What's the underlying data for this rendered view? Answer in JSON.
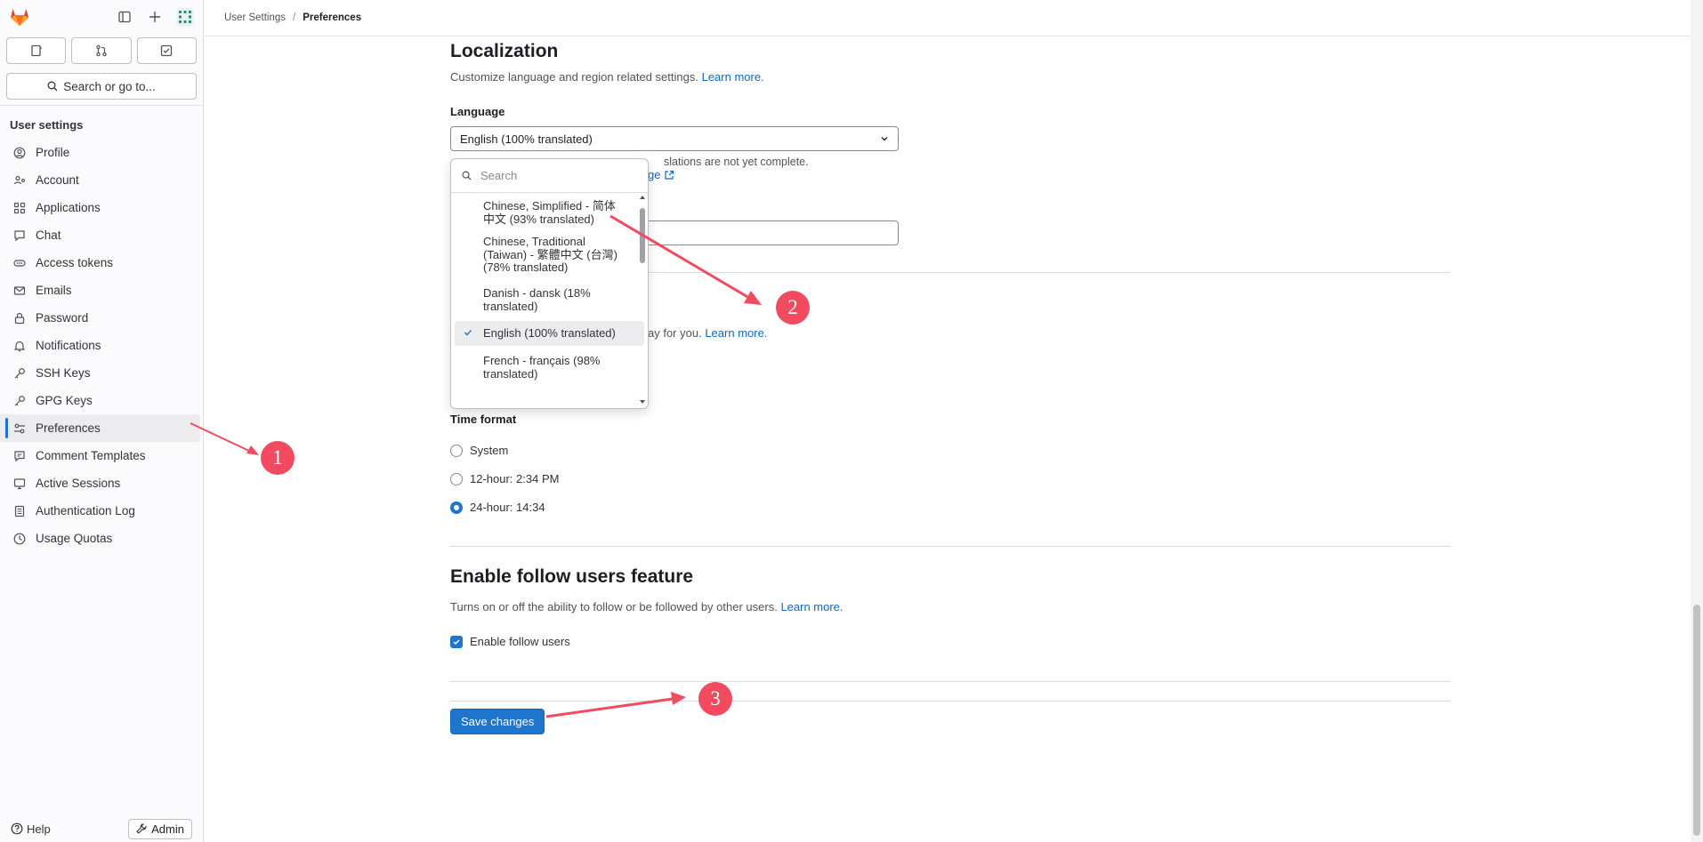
{
  "sidebar": {
    "top_icons": [
      "sidebar-toggle-icon",
      "plus-icon",
      "avatar"
    ],
    "tabs": [
      "issues-icon",
      "merge-request-icon",
      "todo-icon"
    ],
    "search_label": "Search or go to...",
    "heading": "User settings",
    "items": [
      {
        "label": "Profile",
        "icon": "profile-icon"
      },
      {
        "label": "Account",
        "icon": "account-icon"
      },
      {
        "label": "Applications",
        "icon": "applications-icon"
      },
      {
        "label": "Chat",
        "icon": "chat-icon"
      },
      {
        "label": "Access tokens",
        "icon": "token-icon"
      },
      {
        "label": "Emails",
        "icon": "email-icon"
      },
      {
        "label": "Password",
        "icon": "lock-icon"
      },
      {
        "label": "Notifications",
        "icon": "bell-icon"
      },
      {
        "label": "SSH Keys",
        "icon": "key-icon"
      },
      {
        "label": "GPG Keys",
        "icon": "key-icon"
      },
      {
        "label": "Preferences",
        "icon": "preferences-icon",
        "active": true
      },
      {
        "label": "Comment Templates",
        "icon": "comment-icon"
      },
      {
        "label": "Active Sessions",
        "icon": "monitor-icon"
      },
      {
        "label": "Authentication Log",
        "icon": "log-icon"
      },
      {
        "label": "Usage Quotas",
        "icon": "quota-icon"
      }
    ],
    "help_label": "Help",
    "admin_label": "Admin"
  },
  "breadcrumb": {
    "parent": "User Settings",
    "current": "Preferences"
  },
  "localization": {
    "title": "Localization",
    "description": "Customize language and region related settings.",
    "learn_more": "Learn more.",
    "language_label": "Language",
    "language_value": "English (100% translated)",
    "help_text_fragment": "slations are not yet complete.",
    "help_link_fragment": "ge",
    "desc2_fragment": "ay for you.",
    "desc2_link": "Learn more."
  },
  "language_dropdown": {
    "search_placeholder": "Search",
    "options": [
      {
        "line1": "Chinese, Simplified - 简体",
        "line2": "中文 (93% translated)"
      },
      {
        "line1": "Chinese, Traditional",
        "line2": "(Taiwan) - 繁體中文 (台灣)",
        "line3": "(78% translated)"
      },
      {
        "line1": "Danish - dansk (18%",
        "line2": "translated)"
      },
      {
        "line1": "English (100% translated)",
        "selected": true
      },
      {
        "line1": "French - français (98%",
        "line2": "translated)"
      }
    ]
  },
  "time_format": {
    "label": "Time format",
    "options": [
      {
        "label": "System",
        "checked": false
      },
      {
        "label": "12-hour: 2:34 PM",
        "checked": false
      },
      {
        "label": "24-hour: 14:34",
        "checked": true
      }
    ]
  },
  "follow": {
    "title": "Enable follow users feature",
    "description": "Turns on or off the ability to follow or be followed by other users.",
    "learn_more": "Learn more.",
    "checkbox_label": "Enable follow users",
    "checked": true
  },
  "save_button": "Save changes",
  "callouts": [
    "1",
    "2",
    "3"
  ],
  "colors": {
    "accent": "#1f75cb",
    "callout": "#f24a5f",
    "link": "#1068bf"
  }
}
